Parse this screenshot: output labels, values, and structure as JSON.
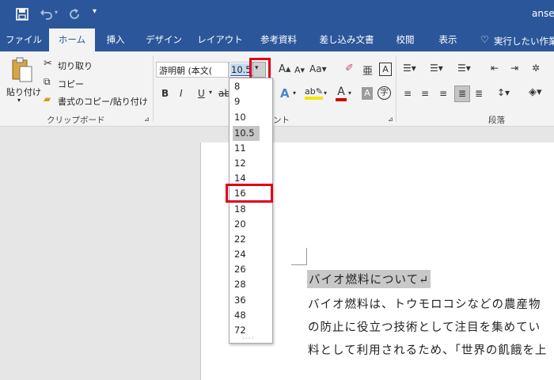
{
  "title_bar": {
    "doc_name": "anse"
  },
  "tabs": [
    "ファイル",
    "ホーム",
    "挿入",
    "デザイン",
    "レイアウト",
    "参考資料",
    "差し込み文書",
    "校閲",
    "表示"
  ],
  "tell_me": "実行したい作業",
  "clipboard": {
    "paste": "貼り付け",
    "cut": "切り取り",
    "copy": "コピー",
    "format_painter": "書式のコピー/貼り付け",
    "group_label": "クリップボード"
  },
  "font": {
    "name": "游明朝 (本文(",
    "size": "10.5",
    "group_label_partial": "ント",
    "bold": "B",
    "italic": "I",
    "underline": "U"
  },
  "paragraph": {
    "group_label": "段落"
  },
  "font_size_options": [
    "8",
    "9",
    "10",
    "10.5",
    "11",
    "12",
    "14",
    "16",
    "18",
    "20",
    "22",
    "24",
    "26",
    "28",
    "36",
    "48",
    "72"
  ],
  "selected_size": "10.5",
  "highlighted_option": "16",
  "document": {
    "heading": "バイオ燃料について↵",
    "line1": "バイオ燃料は、トウモロコシなどの農産物",
    "line2": "の防止に役立つ技術として注目を集めてい",
    "line3": "料として利用されるため、「世界の飢餓を上"
  },
  "colors": {
    "brand_blue": "#2b579a",
    "ribbon_bg": "#f3f3f3",
    "highlight_red": "#e0001b",
    "text_highlight": "#c8c8c8"
  }
}
